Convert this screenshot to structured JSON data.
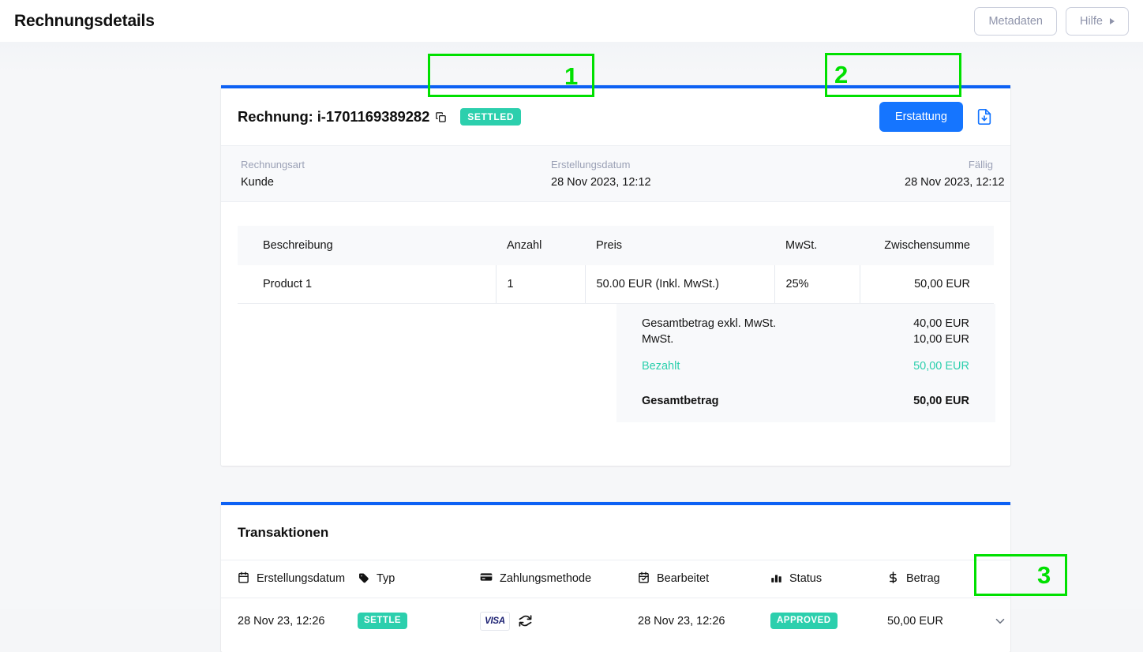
{
  "header": {
    "title": "Rechnungsdetails",
    "metadata_button": "Metadaten",
    "help_button": "Hilfe"
  },
  "invoice": {
    "title": "Rechnung: i-1701169389282",
    "status_badge": "SETTLED",
    "refund_button": "Erstattung",
    "meta": [
      {
        "label": "Rechnungsart",
        "value": "Kunde"
      },
      {
        "label": "Erstellungsdatum",
        "value": "28 Nov 2023, 12:12"
      },
      {
        "label": "Fällig",
        "value": "28 Nov 2023, 12:12"
      }
    ],
    "table": {
      "columns": [
        "Beschreibung",
        "Anzahl",
        "Preis",
        "MwSt.",
        "Zwischensumme"
      ],
      "rows": [
        {
          "description": "Product 1",
          "quantity": "1",
          "price": "50.00 EUR (Inkl. MwSt.)",
          "vat": "25%",
          "subtotal": "50,00 EUR"
        }
      ]
    },
    "totals": [
      {
        "label": "Gesamtbetrag exkl. MwSt.",
        "value": "40,00 EUR"
      },
      {
        "label": "MwSt.",
        "value": "10,00 EUR"
      },
      {
        "label": "Bezahlt",
        "value": "50,00 EUR"
      },
      {
        "label": "Gesamtbetrag",
        "value": "50,00 EUR"
      }
    ]
  },
  "transactions": {
    "section_title": "Transaktionen",
    "columns": [
      {
        "label": "Erstellungsdatum",
        "icon": "calendar-icon"
      },
      {
        "label": "Typ",
        "icon": "tag-icon"
      },
      {
        "label": "Zahlungsmethode",
        "icon": "credit-card-icon"
      },
      {
        "label": "Bearbeitet",
        "icon": "calendar-check-icon"
      },
      {
        "label": "Status",
        "icon": "bar-chart-icon"
      },
      {
        "label": "Betrag",
        "icon": "dollar-icon"
      }
    ],
    "rows": [
      {
        "created": "28 Nov 23, 12:26",
        "type": "SETTLE",
        "card_brand": "VISA",
        "processed": "28 Nov 23, 12:26",
        "status": "APPROVED",
        "amount": "50,00 EUR"
      }
    ]
  },
  "annotations": [
    {
      "number": "1"
    },
    {
      "number": "2"
    },
    {
      "number": "3"
    }
  ],
  "colors": {
    "accent_blue": "#0d61f4",
    "primary_button": "#1575ff",
    "badge_teal": "#2ccfad",
    "annotation_green": "#00e000",
    "page_background": "#f5f6f8"
  }
}
